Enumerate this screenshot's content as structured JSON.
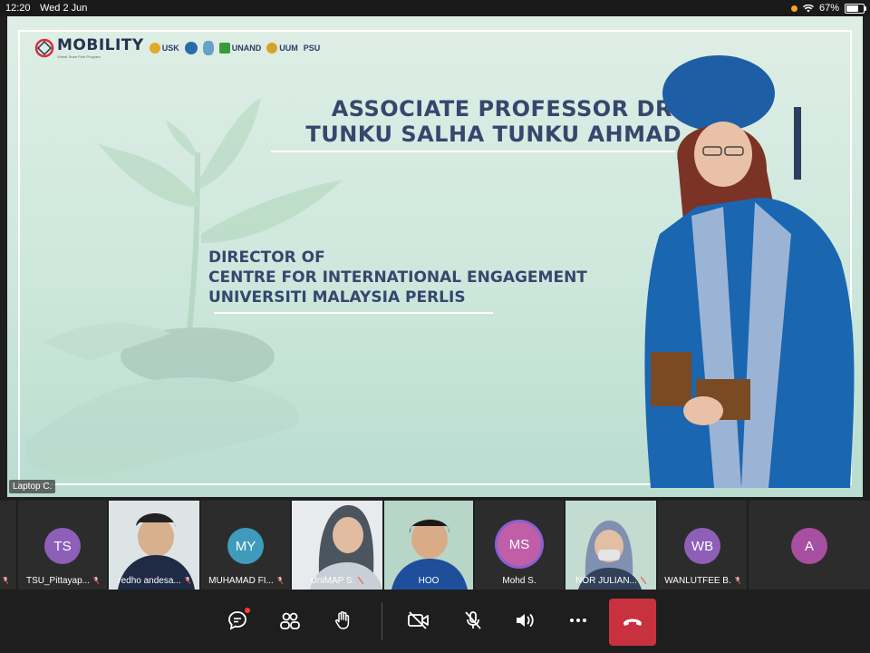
{
  "status_bar": {
    "time": "12:20",
    "date": "Wed 2 Jun",
    "battery": "67%",
    "battery_level": 0.67
  },
  "slide": {
    "logo_brand": "MOBILITY",
    "logo_tagline": "Virtual Team Pole Program",
    "partner_logos": [
      "USK",
      "UNAND",
      "UUM",
      "PSU"
    ],
    "title_line1": "ASSOCIATE PROFESSOR DR.",
    "title_line2": "TUNKU SALHA TUNKU AHMAD",
    "subtitle_line1": "DIRECTOR OF",
    "subtitle_line2": "CENTRE FOR INTERNATIONAL ENGAGEMENT",
    "subtitle_line3": "UNIVERSITI MALAYSIA PERLIS",
    "presenter_label": "Laptop C."
  },
  "participants": [
    {
      "initials": "TS",
      "name": "TSU_Pittayap...",
      "color": "#8e5fb8",
      "video": false
    },
    {
      "initials": "",
      "name": "redho andesa...",
      "color": "",
      "video": true
    },
    {
      "initials": "MY",
      "name": "MUHAMAD FI...",
      "color": "#3f9bbb",
      "video": false
    },
    {
      "initials": "",
      "name": "UniMAP S.",
      "color": "",
      "video": true
    },
    {
      "initials": "",
      "name": "HOO",
      "color": "",
      "video": true
    },
    {
      "initials": "MS",
      "name": "Mohd S.",
      "color": "#c05fa7",
      "video": false
    },
    {
      "initials": "",
      "name": "NOR JULIAN...",
      "color": "",
      "video": true
    },
    {
      "initials": "WB",
      "name": "WANLUTFEE B.",
      "color": "#8e5fb8",
      "video": false
    },
    {
      "initials": "A",
      "name": "",
      "color": "#a74fa0",
      "video": false
    }
  ],
  "controls": {
    "chat_icon": "chat-icon",
    "participants_icon": "participants-icon",
    "raise_hand_icon": "raise-hand-icon",
    "video_off_icon": "video-off-icon",
    "mic_off_icon": "mic-off-icon",
    "speaker_icon": "speaker-icon",
    "more_icon": "more-icon",
    "end_call_icon": "end-call-icon",
    "end_call_color": "#c8323e"
  }
}
